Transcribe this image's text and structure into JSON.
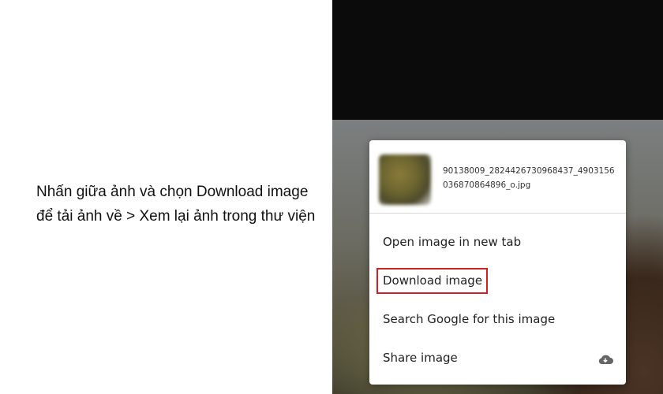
{
  "instruction": {
    "text": "Nhấn giữa ảnh và chọn Download image để tải ảnh về > Xem lại ảnh trong thư viện"
  },
  "context_menu": {
    "filename": "90138009_2824426730968437_4903156036870864896_o.jpg",
    "items": [
      {
        "label": "Open image in new tab"
      },
      {
        "label": "Download image"
      },
      {
        "label": "Search Google for this image"
      },
      {
        "label": "Share image",
        "icon": "cloud-icon"
      }
    ]
  },
  "colors": {
    "highlight_border": "#d21f26",
    "menu_background": "#ffffff",
    "phone_background": "#0b0b0b"
  }
}
